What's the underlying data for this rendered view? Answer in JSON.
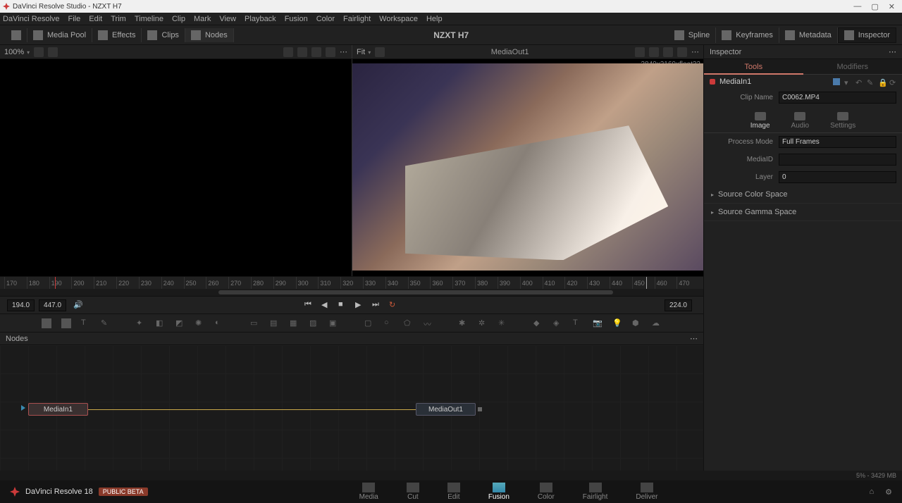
{
  "titlebar": {
    "app": "DaVinci Resolve Studio",
    "project": "NZXT H7"
  },
  "menu": [
    "DaVinci Resolve",
    "File",
    "Edit",
    "Trim",
    "Timeline",
    "Clip",
    "Mark",
    "View",
    "Playback",
    "Fusion",
    "Color",
    "Fairlight",
    "Workspace",
    "Help"
  ],
  "toolbar": {
    "media_pool": "Media Pool",
    "effects": "Effects",
    "clips": "Clips",
    "nodes": "Nodes",
    "title": "NZXT H7",
    "spline": "Spline",
    "keyframes": "Keyframes",
    "metadata": "Metadata",
    "inspector": "Inspector"
  },
  "viewer": {
    "zoom_left": "100%",
    "zoom_right": "Fit",
    "node_label_right": "MediaOut1",
    "resolution": "3840x2160xfloat32"
  },
  "ruler": {
    "ticks": [
      "170",
      "180",
      "190",
      "200",
      "210",
      "220",
      "230",
      "240",
      "250",
      "260",
      "270",
      "280",
      "290",
      "300",
      "310",
      "320",
      "330",
      "340",
      "350",
      "360",
      "370",
      "380",
      "390",
      "400",
      "410",
      "420",
      "430",
      "440",
      "450",
      "460",
      "470"
    ]
  },
  "transport": {
    "in": "194.0",
    "out": "447.0",
    "current": "224.0"
  },
  "nodes_panel": {
    "title": "Nodes",
    "in_node": "MediaIn1",
    "out_node": "MediaOut1"
  },
  "inspector_panel": {
    "header": "Inspector",
    "tabs": {
      "tools": "Tools",
      "modifiers": "Modifiers"
    },
    "node": "MediaIn1",
    "clip_name_label": "Clip Name",
    "clip_name": "C0062.MP4",
    "subtabs": {
      "image": "Image",
      "audio": "Audio",
      "settings": "Settings"
    },
    "rows": {
      "process_mode_label": "Process Mode",
      "process_mode": "Full Frames",
      "mediaid_label": "MediaID",
      "mediaid": "",
      "layer_label": "Layer",
      "layer": "0"
    },
    "collapse": {
      "color_space": "Source Color Space",
      "gamma_space": "Source Gamma Space"
    }
  },
  "status": "5% - 3429 MB",
  "footer": {
    "brand": "DaVinci Resolve 18",
    "beta": "PUBLIC BETA",
    "pages": {
      "media": "Media",
      "cut": "Cut",
      "edit": "Edit",
      "fusion": "Fusion",
      "color": "Color",
      "fairlight": "Fairlight",
      "deliver": "Deliver"
    }
  }
}
